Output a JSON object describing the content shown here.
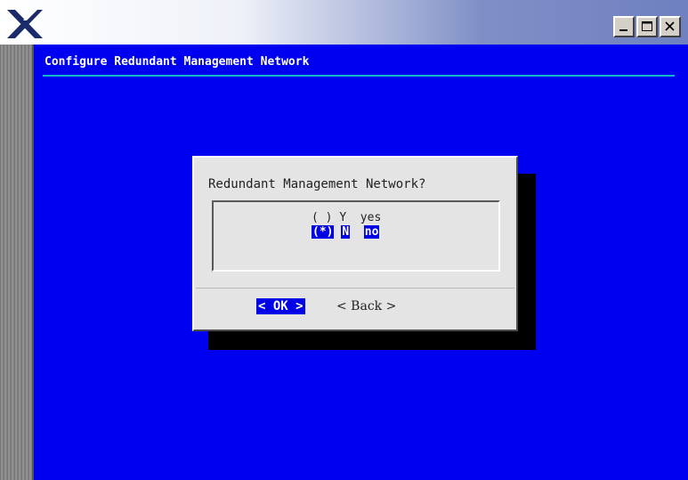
{
  "window": {
    "logo_icon": "x-logo-icon",
    "controls": [
      {
        "name": "minimize-button",
        "icon": "minimize-icon"
      },
      {
        "name": "maximize-button",
        "icon": "maximize-icon"
      },
      {
        "name": "close-button",
        "icon": "close-icon"
      }
    ]
  },
  "screen": {
    "title": "Configure Redundant Management Network",
    "background_color": "#0000f0",
    "rule_color": "#16b8c8"
  },
  "dialog": {
    "question": "Redundant Management Network?",
    "options": [
      {
        "marker": "( )",
        "key": "Y",
        "label": "yes",
        "selected": false
      },
      {
        "marker": "(*)",
        "key": "N",
        "label": "no",
        "selected": true
      }
    ],
    "buttons": {
      "ok": "< OK >",
      "back": "< Back >"
    },
    "highlight_color": "#0000e6"
  }
}
